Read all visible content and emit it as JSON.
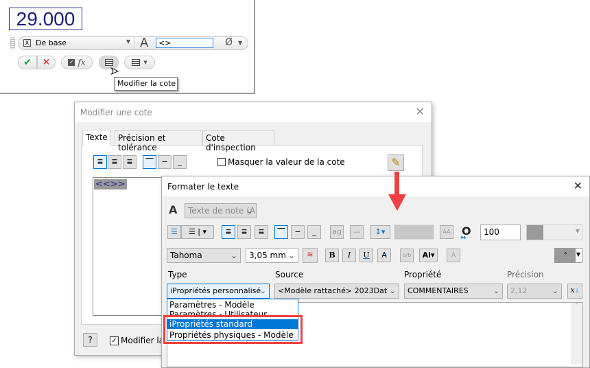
{
  "mini_toolbar": {
    "dimension_value": "29.000",
    "style_value": "De base",
    "text_field": "<>",
    "diameter_symbol": "Ø",
    "fx_label": "fx",
    "tooltip": "Modifier la cote"
  },
  "edit_dim_dialog": {
    "title": "Modifier une cote",
    "tabs": [
      "Texte",
      "Précision et tolérance",
      "Cote d'inspection"
    ],
    "hide_value_label": "Masquer la valeur de la cote",
    "text_content": "<<>>",
    "help_label": "?",
    "edit_checkbox_label": "Modifier la"
  },
  "format_text_dialog": {
    "title": "Formater le texte",
    "style": "Texte de note (AN",
    "stretch_value": "100",
    "font": "Tahoma",
    "size": "3,05 mm",
    "type_label": "Type",
    "type_value": "iPropriétés personnalisé",
    "source_label": "Source",
    "source_value": "<Modèle rattaché> 2023Dat",
    "property_label": "Propriété",
    "property_value": "COMMENTAIRES",
    "precision_label": "Précision",
    "precision_value": "2,12",
    "type_options": [
      "Paramètres - Modèle",
      "Paramètres - Utilisateur",
      "iPropriétés standard",
      "Propriétés physiques - Modèle"
    ]
  },
  "colors": {
    "highlight": "#0078d7",
    "annotation_red": "#f04040"
  }
}
